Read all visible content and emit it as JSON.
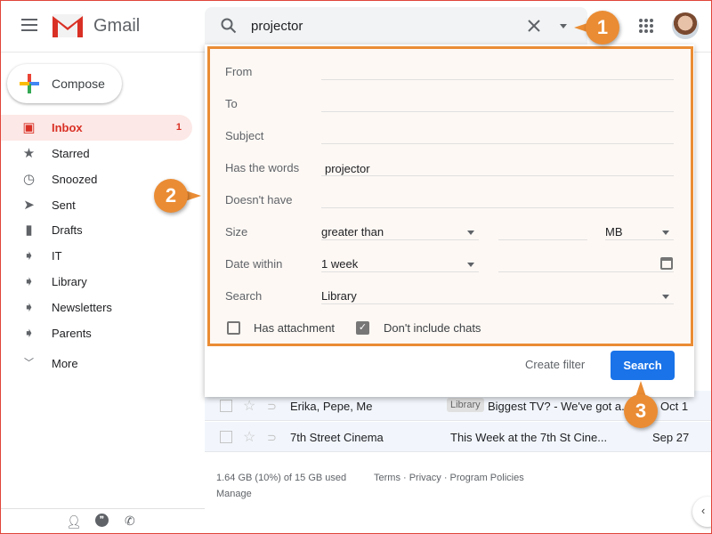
{
  "app": {
    "name": "Gmail"
  },
  "search": {
    "query": "projector"
  },
  "compose": {
    "label": "Compose"
  },
  "sidebar": {
    "items": [
      {
        "label": "Inbox",
        "count": "1",
        "icon": "inbox-icon"
      },
      {
        "label": "Starred",
        "icon": "star-icon"
      },
      {
        "label": "Snoozed",
        "icon": "clock-icon"
      },
      {
        "label": "Sent",
        "icon": "send-icon"
      },
      {
        "label": "Drafts",
        "icon": "draft-icon"
      },
      {
        "label": "IT",
        "icon": "label-icon"
      },
      {
        "label": "Library",
        "icon": "label-icon"
      },
      {
        "label": "Newsletters",
        "icon": "label-icon"
      },
      {
        "label": "Parents",
        "icon": "label-icon"
      },
      {
        "label": "More",
        "icon": "chevron-down-icon"
      }
    ]
  },
  "filter": {
    "from_label": "From",
    "to_label": "To",
    "subject_label": "Subject",
    "has_words_label": "Has the words",
    "has_words_value": "projector",
    "doesnt_have_label": "Doesn't have",
    "size_label": "Size",
    "size_op": "greater than",
    "size_unit": "MB",
    "date_label": "Date within",
    "date_value": "1 week",
    "search_label": "Search",
    "search_value": "Library",
    "has_attachment": "Has attachment",
    "has_attachment_checked": false,
    "dont_include_chats": "Don't include chats",
    "dont_include_chats_checked": true,
    "create_filter": "Create filter",
    "search_button": "Search"
  },
  "emails": [
    {
      "sender": "Erika, Pepe, Me",
      "tag": "Library",
      "subject": "Biggest TV? - We've got a...",
      "date": "Oct 1"
    },
    {
      "sender": "7th Street Cinema",
      "subject": "This Week at the 7th St Cine...",
      "date": "Sep 27"
    }
  ],
  "footer": {
    "storage": "1.64 GB (10%) of 15 GB used",
    "manage": "Manage",
    "links": "Terms · Privacy · Program Policies"
  },
  "callouts": [
    "1",
    "2",
    "3"
  ],
  "colors": {
    "accent": "#ea8c34",
    "search_button": "#1a73e8",
    "inbox": "#d93025"
  }
}
